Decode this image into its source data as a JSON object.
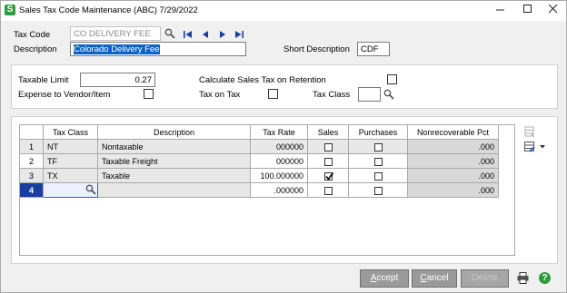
{
  "window": {
    "title": "Sales Tax Code Maintenance (ABC) 7/29/2022",
    "app_icon_letter": "S"
  },
  "header": {
    "tax_code_label": "Tax Code",
    "tax_code_value": "CO DELIVERY FEE",
    "description_label": "Description",
    "description_value": "Colorado Delivery Fee",
    "short_description_label": "Short Description",
    "short_description_value": "CDF"
  },
  "options": {
    "taxable_limit_label": "Taxable Limit",
    "taxable_limit_value": "0.27",
    "expense_label": "Expense to Vendor/Item",
    "calc_retention_label": "Calculate Sales Tax on Retention",
    "tax_on_tax_label": "Tax on Tax",
    "tax_class_label": "Tax Class",
    "tax_class_value": ""
  },
  "grid": {
    "columns": [
      "Tax Class",
      "Description",
      "Tax Rate",
      "Sales",
      "Purchases",
      "Nonrecoverable Pct"
    ],
    "rows": [
      {
        "num": "1",
        "tax_class": "NT",
        "description": "Nontaxable",
        "tax_rate": "000000",
        "sales": false,
        "purchases": false,
        "nonrecoverable": ".000"
      },
      {
        "num": "2",
        "tax_class": "TF",
        "description": "Taxable Freight",
        "tax_rate": "000000",
        "sales": false,
        "purchases": false,
        "nonrecoverable": ".000"
      },
      {
        "num": "3",
        "tax_class": "TX",
        "description": "Taxable",
        "tax_rate": "100.000000",
        "sales": true,
        "purchases": false,
        "nonrecoverable": ".000"
      },
      {
        "num": "4",
        "tax_class": "",
        "description": "",
        "tax_rate": ".000000",
        "sales": false,
        "purchases": false,
        "nonrecoverable": ".000"
      }
    ]
  },
  "buttons": {
    "accept": "Accept",
    "accept_key": "A",
    "accept_rest": "ccept",
    "cancel": "Cancel",
    "cancel_key": "C",
    "cancel_rest": "ancel",
    "delete": "Delete"
  },
  "icons": {
    "accent": "#0a64c8",
    "help_color": "#2e9b3c"
  }
}
